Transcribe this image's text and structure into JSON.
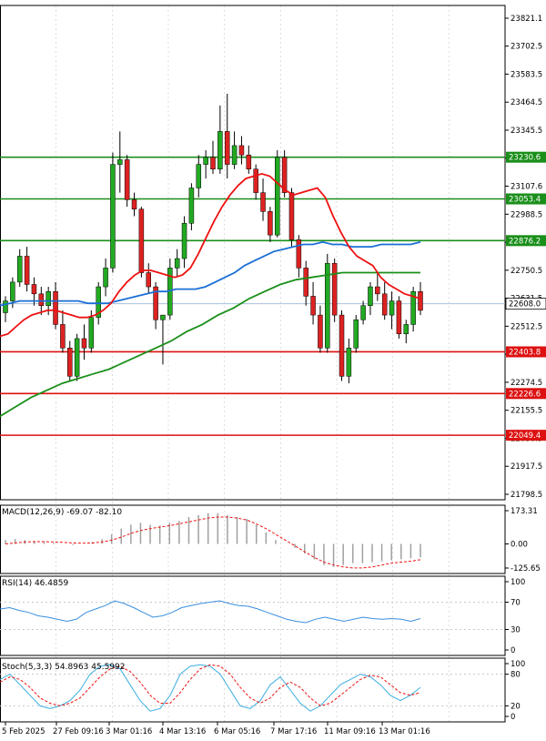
{
  "colors": {
    "background": "#ffffff",
    "grid": "#c8c8c8",
    "axis": "#000000",
    "bull": "#22aa22",
    "bear": "#dd2222",
    "ma_fast": "#ee1111",
    "ma_mid": "#1a6fd6",
    "ma_slow": "#1a8f1a",
    "macd_hist": "#a0a0a0",
    "macd_signal": "#ee1111",
    "rsi": "#3a8fe0",
    "stoch_main": "#3aaee0",
    "stoch_signal": "#ee1111",
    "green_level": "#1a8f1a",
    "red_level": "#dd1111",
    "text": "#000000"
  },
  "panels": {
    "macd": {
      "label": "MACD(12,26,9) -69.07 -82.10",
      "ticks": [
        "173.31",
        "0.00",
        "-125.65"
      ]
    },
    "rsi": {
      "label": "RSI(14) 46.4859",
      "ticks": [
        "100",
        "70",
        "30",
        "0"
      ]
    },
    "stoch": {
      "label": "Stoch(5,3,3) 54.8963 45.5992",
      "ticks": [
        "100",
        "80",
        "20",
        "0"
      ]
    }
  },
  "x_labels": [
    "5 Feb 2025",
    "27 Feb 09:16",
    "3 Mar 01:16",
    "4 Mar 13:16",
    "6 Mar 05:16",
    "7 Mar 17:16",
    "11 Mar 09:16",
    "13 Mar 01:16"
  ],
  "chart_data": {
    "type": "candlestick",
    "price_axis": {
      "range": [
        21798.5,
        23821.1
      ],
      "ticks": [
        "23821.1",
        "23702.5",
        "23583.5",
        "23464.5",
        "23345.5",
        "23226.6",
        "23107.6",
        "22988.5",
        "22869.5",
        "22750.5",
        "22631.5",
        "22512.5",
        "22393.5",
        "22274.5",
        "22155.5",
        "22036.5",
        "21917.5",
        "21798.5"
      ]
    },
    "levels": [
      {
        "value": 23230.6,
        "label": "23230.6",
        "kind": "resistance"
      },
      {
        "value": 23053.4,
        "label": "23053.4",
        "kind": "resistance"
      },
      {
        "value": 22876.2,
        "label": "22876.2",
        "kind": "resistance"
      },
      {
        "value": 22403.8,
        "label": "22403.8",
        "kind": "support"
      },
      {
        "value": 22226.6,
        "label": "22226.6",
        "kind": "support"
      },
      {
        "value": 22049.4,
        "label": "22049.4",
        "kind": "support"
      }
    ],
    "current_price": {
      "value": 22608.0,
      "label": "22608.0"
    },
    "candles": [
      [
        22570,
        22640,
        22530,
        22620
      ],
      [
        22620,
        22720,
        22590,
        22700
      ],
      [
        22700,
        22840,
        22680,
        22810
      ],
      [
        22810,
        22850,
        22660,
        22690
      ],
      [
        22690,
        22720,
        22600,
        22650
      ],
      [
        22650,
        22680,
        22560,
        22600
      ],
      [
        22600,
        22680,
        22560,
        22660
      ],
      [
        22660,
        22700,
        22500,
        22520
      ],
      [
        22520,
        22580,
        22400,
        22420
      ],
      [
        22420,
        22450,
        22280,
        22300
      ],
      [
        22300,
        22480,
        22280,
        22460
      ],
      [
        22460,
        22520,
        22370,
        22420
      ],
      [
        22420,
        22580,
        22400,
        22550
      ],
      [
        22550,
        22700,
        22520,
        22680
      ],
      [
        22680,
        22800,
        22640,
        22760
      ],
      [
        22760,
        23250,
        22740,
        23200
      ],
      [
        23200,
        23340,
        23080,
        23220
      ],
      [
        23220,
        23240,
        23020,
        23050
      ],
      [
        23050,
        23080,
        22980,
        23010
      ],
      [
        23010,
        23020,
        22720,
        22740
      ],
      [
        22740,
        22780,
        22650,
        22680
      ],
      [
        22680,
        22700,
        22500,
        22540
      ],
      [
        22540,
        22560,
        22350,
        22560
      ],
      [
        22560,
        22800,
        22540,
        22760
      ],
      [
        22760,
        22840,
        22720,
        22800
      ],
      [
        22800,
        22980,
        22760,
        22950
      ],
      [
        22950,
        23120,
        22920,
        23100
      ],
      [
        23100,
        23240,
        23060,
        23200
      ],
      [
        23200,
        23260,
        23140,
        23230
      ],
      [
        23230,
        23300,
        23160,
        23180
      ],
      [
        23180,
        23450,
        23160,
        23340
      ],
      [
        23340,
        23500,
        23140,
        23200
      ],
      [
        23200,
        23340,
        23180,
        23280
      ],
      [
        23280,
        23320,
        23200,
        23240
      ],
      [
        23240,
        23280,
        23160,
        23180
      ],
      [
        23180,
        23200,
        23050,
        23080
      ],
      [
        23080,
        23140,
        22960,
        23000
      ],
      [
        23000,
        23020,
        22870,
        22900
      ],
      [
        22900,
        23260,
        22890,
        23230
      ],
      [
        23230,
        23260,
        23060,
        23080
      ],
      [
        23080,
        23100,
        22850,
        22880
      ],
      [
        22880,
        22900,
        22720,
        22760
      ],
      [
        22760,
        22790,
        22600,
        22640
      ],
      [
        22640,
        22700,
        22520,
        22560
      ],
      [
        22560,
        22600,
        22400,
        22420
      ],
      [
        22420,
        22820,
        22400,
        22780
      ],
      [
        22780,
        22800,
        22530,
        22560
      ],
      [
        22560,
        22580,
        22280,
        22300
      ],
      [
        22300,
        22460,
        22270,
        22420
      ],
      [
        22420,
        22560,
        22400,
        22540
      ],
      [
        22540,
        22620,
        22520,
        22600
      ],
      [
        22600,
        22700,
        22560,
        22680
      ],
      [
        22680,
        22740,
        22620,
        22650
      ],
      [
        22650,
        22700,
        22540,
        22560
      ],
      [
        22560,
        22660,
        22500,
        22620
      ],
      [
        22620,
        22640,
        22460,
        22480
      ],
      [
        22480,
        22540,
        22440,
        22520
      ],
      [
        22520,
        22680,
        22490,
        22660
      ],
      [
        22660,
        22700,
        22560,
        22580
      ]
    ],
    "ma_fast": [
      22470,
      22480,
      22510,
      22540,
      22560,
      22570,
      22580,
      22580,
      22570,
      22560,
      22550,
      22550,
      22560,
      22580,
      22610,
      22660,
      22700,
      22730,
      22750,
      22750,
      22740,
      22730,
      22720,
      22730,
      22760,
      22820,
      22890,
      22960,
      23020,
      23070,
      23110,
      23140,
      23150,
      23160,
      23150,
      23120,
      23090,
      23070,
      23080,
      23090,
      23100,
      23060,
      22980,
      22910,
      22850,
      22810,
      22790,
      22770,
      22720,
      22690,
      22670,
      22650,
      22640,
      22630
    ],
    "ma_mid": [
      22600,
      22610,
      22620,
      22620,
      22620,
      22620,
      22620,
      22620,
      22620,
      22610,
      22610,
      22610,
      22620,
      22630,
      22640,
      22650,
      22660,
      22660,
      22670,
      22670,
      22670,
      22680,
      22700,
      22720,
      22740,
      22770,
      22790,
      22810,
      22830,
      22840,
      22850,
      22860,
      22860,
      22870,
      22860,
      22860,
      22850,
      22850,
      22850,
      22860,
      22860,
      22860,
      22860,
      22870
    ],
    "ma_slow": [
      22130,
      22170,
      22210,
      22240,
      22270,
      22290,
      22310,
      22330,
      22360,
      22390,
      22420,
      22450,
      22490,
      22520,
      22560,
      22590,
      22630,
      22660,
      22690,
      22710,
      22720,
      22730,
      22740,
      22740,
      22740,
      22740,
      22740,
      22740
    ],
    "macd_hist": [
      20,
      25,
      20,
      15,
      10,
      5,
      0,
      -5,
      0,
      10,
      25,
      50,
      80,
      100,
      110,
      100,
      95,
      110,
      120,
      140,
      150,
      160,
      160,
      150,
      140,
      130,
      100,
      60,
      20,
      0,
      -20,
      -50,
      -80,
      -110,
      -120,
      -110,
      -100,
      -100,
      -95,
      -90,
      -85,
      -80,
      -75,
      -70
    ],
    "macd_signal": [
      0,
      5,
      10,
      12,
      12,
      10,
      8,
      5,
      4,
      5,
      10,
      20,
      35,
      55,
      70,
      80,
      88,
      95,
      105,
      115,
      125,
      135,
      140,
      140,
      135,
      125,
      105,
      80,
      50,
      20,
      -10,
      -40,
      -70,
      -95,
      -110,
      -120,
      -125,
      -125,
      -120,
      -110,
      -100,
      -95,
      -90,
      -82
    ],
    "rsi": [
      60,
      62,
      58,
      55,
      50,
      48,
      45,
      42,
      45,
      55,
      60,
      65,
      72,
      68,
      62,
      55,
      48,
      50,
      55,
      62,
      65,
      68,
      70,
      72,
      68,
      65,
      64,
      60,
      55,
      50,
      45,
      42,
      40,
      45,
      48,
      45,
      42,
      45,
      48,
      46,
      45,
      46,
      45,
      42,
      46
    ],
    "stoch_main": [
      70,
      80,
      60,
      40,
      20,
      15,
      20,
      30,
      50,
      80,
      95,
      98,
      90,
      60,
      30,
      10,
      15,
      40,
      80,
      95,
      98,
      95,
      80,
      50,
      20,
      15,
      30,
      60,
      75,
      50,
      25,
      10,
      20,
      40,
      60,
      70,
      80,
      75,
      60,
      40,
      30,
      40,
      55
    ],
    "stoch_signal": [
      65,
      75,
      70,
      55,
      35,
      25,
      20,
      25,
      35,
      55,
      75,
      90,
      95,
      85,
      65,
      40,
      25,
      25,
      45,
      70,
      90,
      98,
      95,
      80,
      55,
      35,
      25,
      35,
      55,
      65,
      55,
      35,
      20,
      25,
      40,
      55,
      70,
      78,
      75,
      60,
      45,
      40,
      45
    ]
  }
}
